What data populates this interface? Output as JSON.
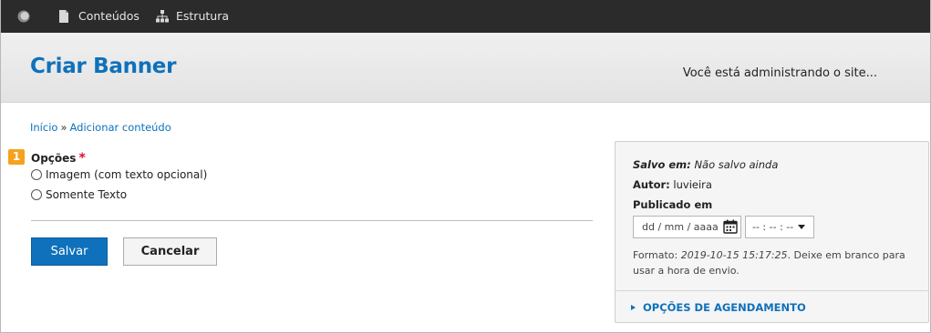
{
  "toolbar": {
    "logo_icon": "drupal-drop-icon",
    "items": [
      {
        "label": "Conteúdos",
        "icon": "file-icon"
      },
      {
        "label": "Estrutura",
        "icon": "sitemap-icon"
      }
    ]
  },
  "header": {
    "title": "Criar Banner",
    "site_note": "Você está administrando o site..."
  },
  "breadcrumb": {
    "home": "Início",
    "separator": "»",
    "current": "Adicionar conteúdo"
  },
  "form": {
    "step_badge": "1",
    "options_label": "Opções",
    "required_mark": "*",
    "radios": [
      {
        "label": "Imagem (com texto opcional)",
        "checked": false
      },
      {
        "label": "Somente Texto",
        "checked": false
      }
    ],
    "save_label": "Salvar",
    "cancel_label": "Cancelar"
  },
  "side_panel": {
    "saved_label": "Salvo em:",
    "saved_value": "Não salvo ainda",
    "author_label": "Autor:",
    "author_value": "luvieira",
    "published_label": "Publicado em",
    "date_placeholder": "dd / mm / aaaa",
    "time_placeholder": "-- : -- : --",
    "format_prefix": "Formato:",
    "format_example": "2019-10-15 15:17:25",
    "format_suffix": ". Deixe em branco para usar a hora de envio.",
    "schedule_toggle": "OPÇÕES DE AGENDAMENTO"
  },
  "colors": {
    "accent": "#0f71bb",
    "toolbar_bg": "#2b2b2b",
    "badge": "#f6a21d",
    "required": "#d2142b"
  }
}
